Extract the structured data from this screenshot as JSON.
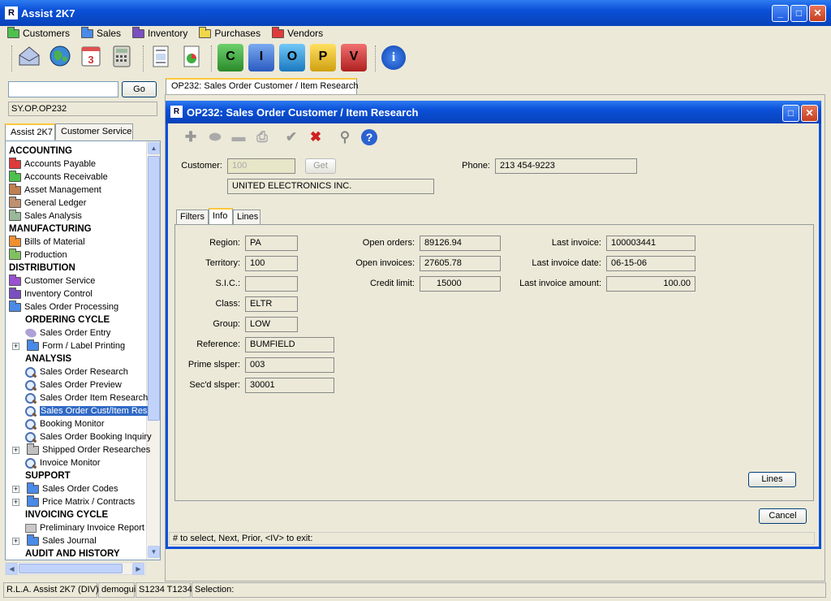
{
  "app": {
    "title": "Assist 2K7"
  },
  "menus": [
    {
      "label": "Customers",
      "color": "#4CC24C"
    },
    {
      "label": "Sales",
      "color": "#4A8AE8"
    },
    {
      "label": "Inventory",
      "color": "#7B4FC0"
    },
    {
      "label": "Purchases",
      "color": "#F2D64A"
    },
    {
      "label": "Vendors",
      "color": "#E03A3A"
    }
  ],
  "toolbar": {
    "icons": [
      "mail-icon",
      "globe-icon",
      "calendar-icon",
      "calculator-icon",
      "document-icon",
      "chart-icon",
      "c-icon",
      "i-icon",
      "o-icon",
      "p-icon",
      "v-icon",
      "info-icon"
    ],
    "calendar_text": "3",
    "c": "C",
    "i": "I",
    "o": "O",
    "p": "P",
    "v": "V",
    "info": "i"
  },
  "left": {
    "search_value": "",
    "go_label": "Go",
    "path": "SY.OP.OP232",
    "tabs": [
      "Assist 2K7",
      "Customer Service"
    ],
    "tree": [
      {
        "label": "ACCOUNTING",
        "type": "head",
        "indent": 0
      },
      {
        "label": "Accounts Payable",
        "type": "folder",
        "color": "#E03A3A",
        "indent": 0
      },
      {
        "label": "Accounts Receivable",
        "type": "folder",
        "color": "#4CC24C",
        "indent": 0
      },
      {
        "label": "Asset Management",
        "type": "folder",
        "color": "#C08050",
        "indent": 0
      },
      {
        "label": "General Ledger",
        "type": "folder",
        "color": "#C09070",
        "indent": 0
      },
      {
        "label": "Sales Analysis",
        "type": "folder",
        "color": "#9AB89A",
        "indent": 0
      },
      {
        "label": "MANUFACTURING",
        "type": "head",
        "indent": 0
      },
      {
        "label": "Bills of Material",
        "type": "folder",
        "color": "#F09030",
        "indent": 0
      },
      {
        "label": "Production",
        "type": "folder",
        "color": "#80C060",
        "indent": 0
      },
      {
        "label": "DISTRIBUTION",
        "type": "head",
        "indent": 0
      },
      {
        "label": "Customer Service",
        "type": "folder",
        "color": "#9A50D0",
        "indent": 0
      },
      {
        "label": "Inventory Control",
        "type": "folder",
        "color": "#7B4FC0",
        "indent": 0
      },
      {
        "label": "Sales Order Processing",
        "type": "folder",
        "color": "#4A8AE8",
        "indent": 0
      },
      {
        "label": "ORDERING CYCLE",
        "type": "head",
        "indent": 1
      },
      {
        "label": "Sales Order Entry",
        "type": "leaf",
        "indent": 2
      },
      {
        "label": "Form / Label Printing",
        "type": "expfolder",
        "color": "#4A8AE8",
        "indent": 1
      },
      {
        "label": "ANALYSIS",
        "type": "head",
        "indent": 1
      },
      {
        "label": "Sales Order Research",
        "type": "search",
        "indent": 2
      },
      {
        "label": "Sales Order Preview",
        "type": "search",
        "indent": 2
      },
      {
        "label": "Sales Order Item Research",
        "type": "search",
        "indent": 2
      },
      {
        "label": "Sales Order Cust/Item Res",
        "type": "search",
        "indent": 2,
        "selected": true
      },
      {
        "label": "Booking Monitor",
        "type": "search",
        "indent": 2
      },
      {
        "label": "Sales Order Booking Inquiry",
        "type": "search",
        "indent": 2
      },
      {
        "label": "Shipped Order Researches",
        "type": "expfolder",
        "color": "#C0C0C0",
        "indent": 1
      },
      {
        "label": "Invoice Monitor",
        "type": "search",
        "indent": 2
      },
      {
        "label": "SUPPORT",
        "type": "head",
        "indent": 1
      },
      {
        "label": "Sales Order Codes",
        "type": "expfolder",
        "color": "#4A8AE8",
        "indent": 1
      },
      {
        "label": "Price Matrix / Contracts",
        "type": "expfolder",
        "color": "#4A8AE8",
        "indent": 1
      },
      {
        "label": "INVOICING CYCLE",
        "type": "head",
        "indent": 1
      },
      {
        "label": "Preliminary Invoice Report",
        "type": "print",
        "indent": 2
      },
      {
        "label": "Sales Journal",
        "type": "expfolder",
        "color": "#4A8AE8",
        "indent": 1
      },
      {
        "label": "AUDIT AND HISTORY",
        "type": "head",
        "indent": 1
      }
    ]
  },
  "doc_tab": "OP232: Sales Order Customer / Item Research",
  "form": {
    "title": "OP232: Sales Order Customer / Item Research",
    "customer_label": "Customer:",
    "customer_value": "100",
    "get_label": "Get",
    "phone_label": "Phone:",
    "phone_value": "213 454-9223",
    "customer_name": "UNITED ELECTRONICS INC.",
    "tabs": [
      "Filters",
      "Info",
      "Lines"
    ],
    "col1": [
      {
        "label": "Region:",
        "value": "PA"
      },
      {
        "label": "Territory:",
        "value": "100"
      },
      {
        "label": "S.I.C.:",
        "value": ""
      },
      {
        "label": "Class:",
        "value": "ELTR"
      },
      {
        "label": "Group:",
        "value": "LOW"
      },
      {
        "label": "Reference:",
        "value": "BUMFIELD"
      },
      {
        "label": "Prime slsper:",
        "value": "003"
      },
      {
        "label": "Sec'd slsper:",
        "value": "30001"
      }
    ],
    "col2": [
      {
        "label": "Open orders:",
        "value": "89126.94"
      },
      {
        "label": "Open invoices:",
        "value": "27605.78"
      },
      {
        "label": "Credit limit:",
        "value": "15000"
      }
    ],
    "col3": [
      {
        "label": "Last invoice:",
        "value": "100003441"
      },
      {
        "label": "Last invoice date:",
        "value": "06-15-06"
      },
      {
        "label": "Last invoice amount:",
        "value": "100.00"
      }
    ],
    "lines_button": "Lines",
    "cancel_button": "Cancel",
    "hint": "# to select,  Next,  Prior,  <IV> to exit:"
  },
  "status": {
    "product": "R.L.A. Assist 2K7 (DIV)",
    "user": "demogui",
    "terminal": "S1234 T1234",
    "selection": "Selection:"
  }
}
